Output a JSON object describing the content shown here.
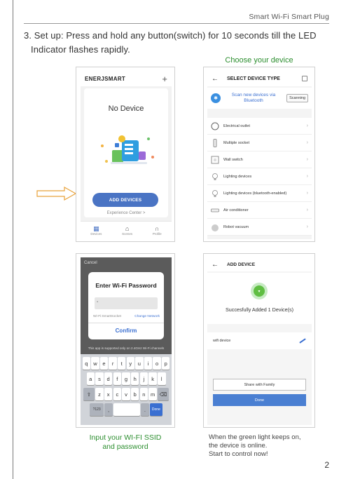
{
  "header": {
    "title": "Smart Wi-Fi Smart Plug"
  },
  "step": {
    "line1": "3. Set up: Press and hold any button(switch) for 10 seconds till the LED",
    "line2": "Indicator flashes rapidly."
  },
  "choose_label": "Choose your device",
  "screen1": {
    "brand": "ENERJSMART",
    "plus": "+",
    "no_device": "No Device",
    "add_button": "ADD DEVICES",
    "experience": "Experience Center >",
    "tabs": [
      {
        "icon": "grid-icon",
        "label": "Devices",
        "glyph": "▦"
      },
      {
        "icon": "home-icon",
        "label": "Scenes",
        "glyph": "⌂"
      },
      {
        "icon": "profile-icon",
        "label": "Profile",
        "glyph": "∩"
      }
    ]
  },
  "screen2": {
    "back": "←",
    "title": "SELECT DEVICE TYPE",
    "bt_text_1": "Scan new devices via",
    "bt_text_2": "Bluetooth",
    "scanning": "Scanning",
    "devices": [
      {
        "label": "Electrical outlet",
        "icon": "outlet-icon"
      },
      {
        "label": "Multiple socket",
        "icon": "power-strip-icon"
      },
      {
        "label": "Wall switch",
        "icon": "wall-switch-icon"
      },
      {
        "label": "Lighting devices",
        "icon": "bulb-icon"
      },
      {
        "label": "Lighting devices (bluetooth-enabled)",
        "icon": "bulb-icon"
      },
      {
        "label": "Air conditioner",
        "icon": "air-conditioner-icon"
      },
      {
        "label": "Robot vacuum",
        "icon": "robot-vacuum-icon"
      }
    ]
  },
  "screen3": {
    "cancel": "Cancel",
    "title": "Enter Wi-Fi Password",
    "ssid": "Wi-Fi:SmartSocket",
    "change_network": "Change Network",
    "confirm": "Confirm",
    "support_note": "This app is supported only on 2.4GHz Wi-Fi channels",
    "keyboard": {
      "row1": [
        "q",
        "w",
        "e",
        "r",
        "t",
        "y",
        "u",
        "i",
        "o",
        "p"
      ],
      "row2": [
        "a",
        "s",
        "d",
        "f",
        "g",
        "h",
        "j",
        "k",
        "l"
      ],
      "row3": [
        "⇧",
        "z",
        "x",
        "c",
        "v",
        "b",
        "n",
        "m",
        "⌫"
      ],
      "row4": [
        "?123",
        ",",
        "",
        ".",
        "Done"
      ]
    }
  },
  "screen4": {
    "back": "←",
    "title": "ADD DEVICE",
    "success": "Succesfully Added 1 Device(s)",
    "device_name": "wifi device",
    "share": "Share with Family",
    "done": "Done"
  },
  "captions": {
    "left_1": "Input your WI-FI SSID",
    "left_2": "and password",
    "right_1": "When the green light keeps on,",
    "right_2": "the device is online.",
    "right_3": "Start to control now!"
  },
  "page_number": "2",
  "colors": {
    "accent_green": "#2c8e2f",
    "button_blue": "#4a74c4",
    "link_blue": "#3a6fd1"
  }
}
